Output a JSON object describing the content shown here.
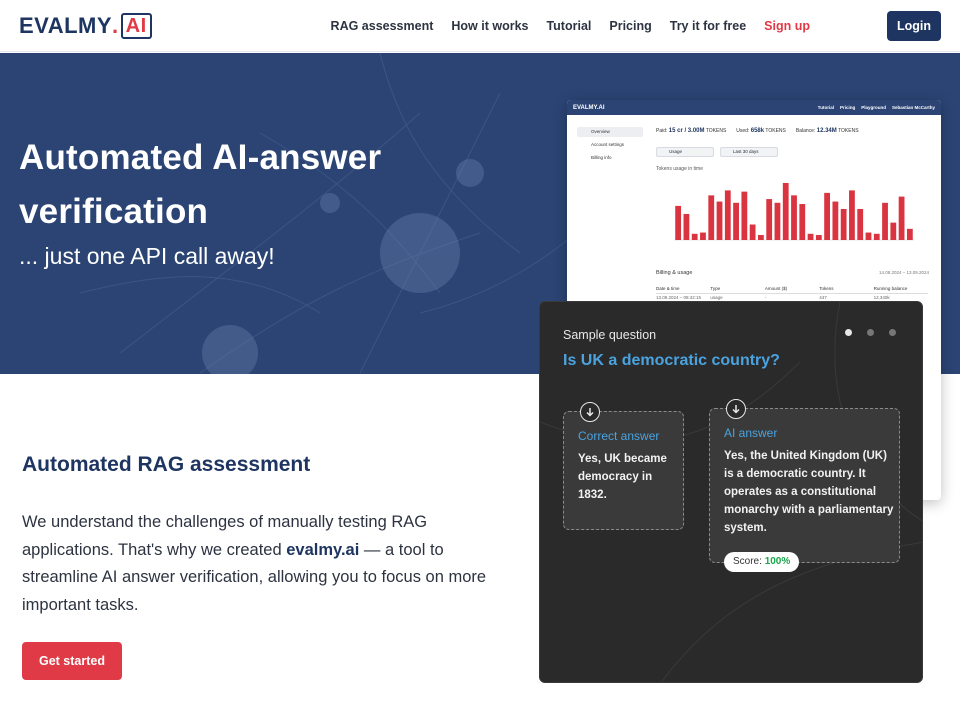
{
  "brand": {
    "logo_text": "EVALMY",
    "logo_dot": ".",
    "logo_ai": "AI"
  },
  "nav": {
    "items": [
      "RAG assessment",
      "How it works",
      "Tutorial",
      "Pricing",
      "Try it for free"
    ],
    "signup": "Sign up",
    "login": "Login"
  },
  "hero": {
    "title": "Automated AI-answer verification",
    "subtitle": "... just one API call away!"
  },
  "dashboard": {
    "logo": "EVALMY.AI",
    "nav": [
      "Tutorial",
      "Pricing",
      "Playground",
      "Sebastian McCarthy"
    ],
    "sidebar": [
      "Overview",
      "Account settings",
      "Billing info"
    ],
    "stats": [
      {
        "label": "Paid:",
        "value": "15 cr / 3.00M",
        "unit": "TOKENS"
      },
      {
        "label": "Used:",
        "value": "658k",
        "unit": "TOKENS"
      },
      {
        "label": "Balance:",
        "value": "12.34M",
        "unit": "TOKENS"
      }
    ],
    "filters": [
      "Usage",
      "Last 30 days"
    ],
    "chart_title": "Tokens usage in time",
    "billing_title": "Billing & usage",
    "billing_range": "14.08.2024 – 13.09.2024",
    "table_headers": [
      "Date & time",
      "Type",
      "Amount ($)",
      "Tokens",
      "Running balance"
    ],
    "table_row": [
      "13.09.2024 – 08:42:15",
      "usage",
      "-",
      "447",
      "12,340k"
    ],
    "bar_levels": [
      0.55,
      0.42,
      0.1,
      0.12,
      0.72,
      0.62,
      0.8,
      0.6,
      0.78,
      0.25,
      0.08,
      0.66,
      0.6,
      0.92,
      0.72,
      0.58,
      0.1,
      0.08,
      0.76,
      0.62,
      0.5,
      0.8,
      0.5,
      0.12,
      0.1,
      0.6,
      0.28,
      0.7,
      0.18
    ]
  },
  "sample": {
    "label": "Sample question",
    "question": "Is UK a democratic country?",
    "correct_title": "Correct answer",
    "correct_text": "Yes, UK became democracy in 1832.",
    "ai_title": "AI answer",
    "ai_text": "Yes, the United Kingdom (UK) is a democratic country. It operates as a constitutional monarchy with a parliamentary system.",
    "score_label": "Score:",
    "score_value": "100%"
  },
  "section": {
    "title": "Automated RAG assessment",
    "body_before": "We understand the challenges of manually testing RAG applications. That's why we created ",
    "body_brand": "evalmy.ai",
    "body_after": " — a tool to streamline AI answer verification, allowing you to focus on more important tasks.",
    "cta": "Get started"
  },
  "colors": {
    "navy": "#1e3561",
    "hero_bg": "#2b4474",
    "accent_red": "#e03a46",
    "link_blue": "#4aa3df",
    "score_green": "#1aa64a"
  }
}
